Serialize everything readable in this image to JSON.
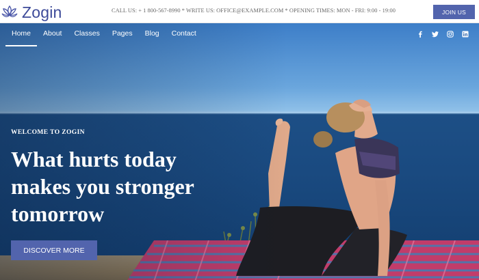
{
  "brand": {
    "name": "Zogin",
    "logo_icon": "lotus-icon",
    "color": "#3d4a99"
  },
  "topbar": {
    "contact_line": "CALL US: + 1 800-567-8990 * WRITE US: OFFICE@EXAMPLE.COM * OPENING TIMES: MON - FRI: 9:00 - 19:00",
    "join_label": "JOIN US"
  },
  "nav": {
    "items": [
      {
        "label": "Home",
        "active": true
      },
      {
        "label": "About"
      },
      {
        "label": "Classes"
      },
      {
        "label": "Pages"
      },
      {
        "label": "Blog"
      },
      {
        "label": "Contact"
      }
    ]
  },
  "social": [
    "facebook-icon",
    "twitter-icon",
    "instagram-icon",
    "linkedin-icon"
  ],
  "hero": {
    "eyebrow": "WELCOME TO ZOGIN",
    "headline_lines": [
      "What hurts today",
      "makes you stronger",
      "tomorrow"
    ],
    "cta_label": "DISCOVER MORE"
  },
  "colors": {
    "accent": "#5264ad",
    "sky": "#5d9ad6",
    "sea": "#1a4a80"
  }
}
